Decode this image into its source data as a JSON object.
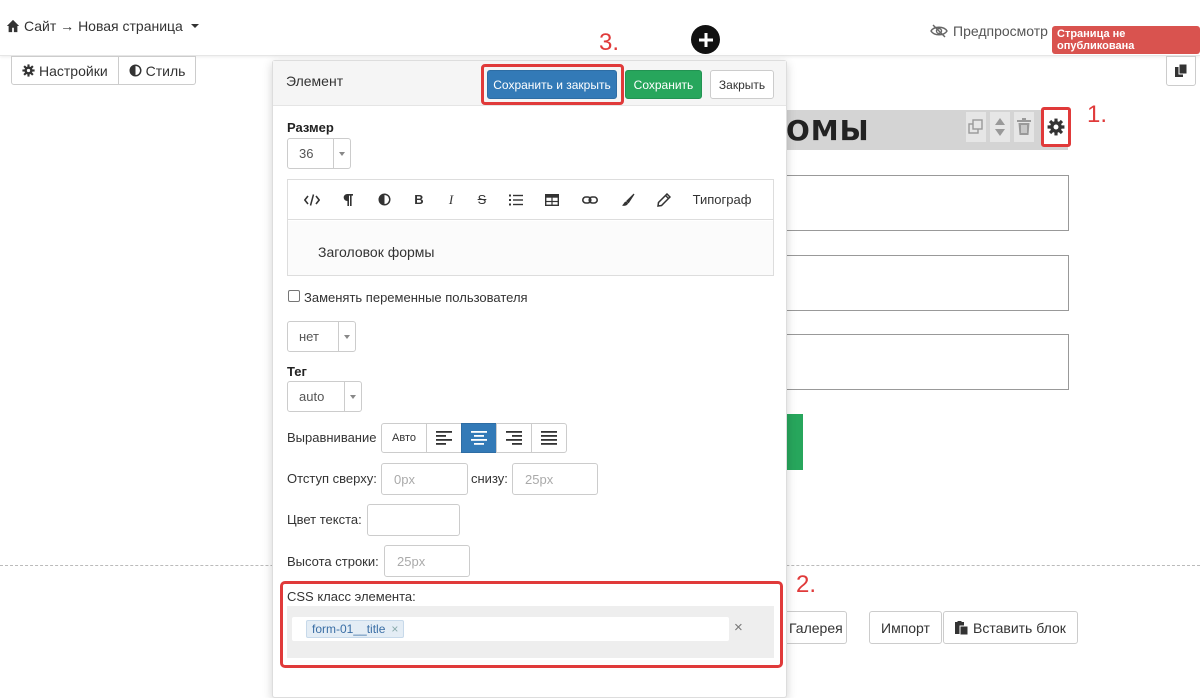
{
  "topbar": {
    "breadcrumb": "Сайт → Новая страница",
    "preview_label": "Предпросмотр",
    "status_badge": "Страница не опубликована"
  },
  "toolbar": {
    "settings_label": "Настройки",
    "style_label": "Стиль"
  },
  "background": {
    "heading_fragment": "ОМЫ",
    "gallery_label": "Галерея",
    "import_label": "Импорт",
    "paste_block_label": "Вставить блок"
  },
  "annotations": {
    "step1": "1.",
    "step2": "2.",
    "step3": "3."
  },
  "modal": {
    "title": "Элемент",
    "save_close_label": "Сохранить и закрыть",
    "save_label": "Сохранить",
    "close_label": "Закрыть",
    "size": {
      "label": "Размер",
      "value": "36"
    },
    "editor": {
      "tools": [
        "code-icon",
        "paragraph-icon",
        "contrast-icon",
        "bold-icon",
        "italic-icon",
        "strike-icon",
        "list-icon",
        "table-icon",
        "link-icon",
        "brush-icon",
        "pencil-icon"
      ],
      "bold_glyph": "B",
      "italic_glyph": "I",
      "strike_glyph": "S",
      "typograf_label": "Типограф",
      "content": "Заголовок формы"
    },
    "replace_vars": {
      "label": "Заменять переменные пользователя",
      "checked": false
    },
    "replace_select": {
      "value": "нет"
    },
    "tag": {
      "label": "Тег",
      "value": "auto"
    },
    "alignment": {
      "label": "Выравнивание",
      "auto_label": "Авто",
      "selected": "center"
    },
    "margin": {
      "top_label": "Отступ сверху:",
      "top_placeholder": "0px",
      "bottom_label": "снизу:",
      "bottom_placeholder": "25px"
    },
    "text_color": {
      "label": "Цвет текста:"
    },
    "line_height": {
      "label": "Высота строки:",
      "placeholder": "25px"
    },
    "css_class": {
      "label": "CSS класс элемента:",
      "tags": [
        "form-01__title"
      ]
    }
  },
  "colors": {
    "primary": "#337ab7",
    "success": "#27a65c",
    "danger": "#d9534f",
    "annotation": "#e03a3a"
  }
}
